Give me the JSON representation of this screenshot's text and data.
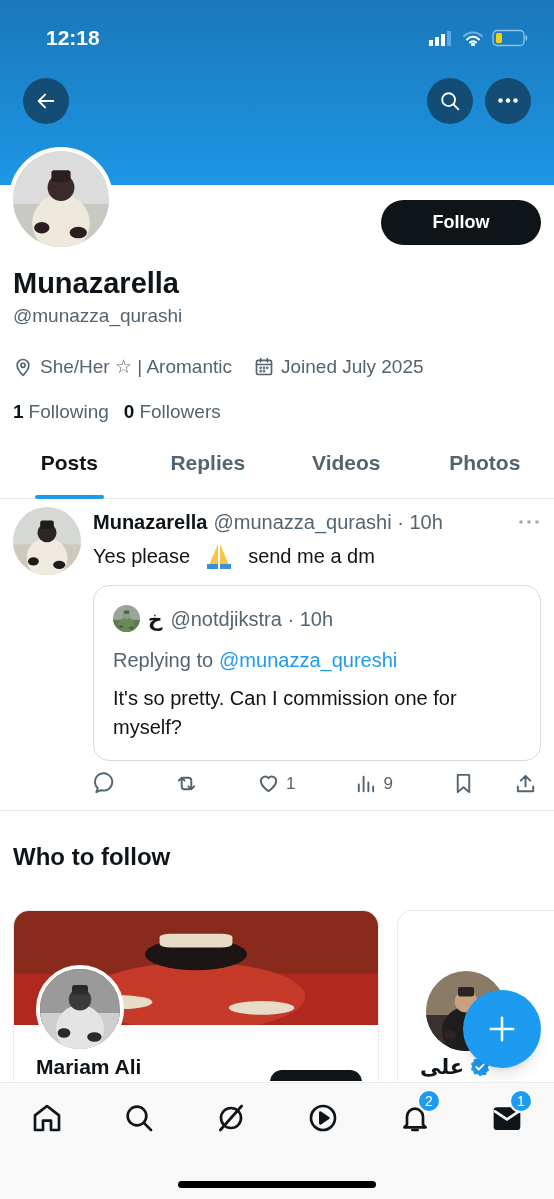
{
  "status_bar": {
    "time": "12:18"
  },
  "profile": {
    "name": "Munazarella",
    "handle": "@munazza_qurashi",
    "follow_button": "Follow",
    "meta": [
      {
        "kind": "location",
        "text": "She/Her ☆ | Aromantic"
      },
      {
        "kind": "calendar",
        "text": "Joined July 2025"
      }
    ],
    "stats": [
      {
        "count": "1",
        "label": "Following"
      },
      {
        "count": "0",
        "label": "Followers"
      }
    ]
  },
  "tabs": [
    {
      "label": "Posts",
      "selected": true
    },
    {
      "label": "Replies",
      "selected": false
    },
    {
      "label": "Videos",
      "selected": false
    },
    {
      "label": "Photos",
      "selected": false
    }
  ],
  "post": {
    "author": "Munazarella",
    "meta": "@munazza_qurashi · 10h",
    "text_before": "Yes please",
    "text_after": "send me a dm",
    "quote": {
      "name": "خ",
      "meta": "@notdjikstra · 10h",
      "replying_label": "Replying to",
      "replying_handle": "@munazza_qureshi",
      "text": "It's so pretty. Can I commission one for myself?"
    },
    "actions": [
      {
        "kind": "reply"
      },
      {
        "kind": "repost"
      },
      {
        "kind": "like",
        "count": "1"
      },
      {
        "kind": "views",
        "count": "9"
      },
      {
        "kind": "bookmark"
      },
      {
        "kind": "share"
      }
    ]
  },
  "who_to_follow": {
    "title": "Who to follow",
    "cards": [
      {
        "name": "Mariam Ali",
        "verified": false,
        "has_banner": true
      },
      {
        "name": "علی",
        "verified": true,
        "has_banner": false
      }
    ]
  },
  "nav": [
    {
      "kind": "home"
    },
    {
      "kind": "search"
    },
    {
      "kind": "grok"
    },
    {
      "kind": "video"
    },
    {
      "kind": "notifications",
      "badge": "2"
    },
    {
      "kind": "messages",
      "badge": "1"
    }
  ]
}
